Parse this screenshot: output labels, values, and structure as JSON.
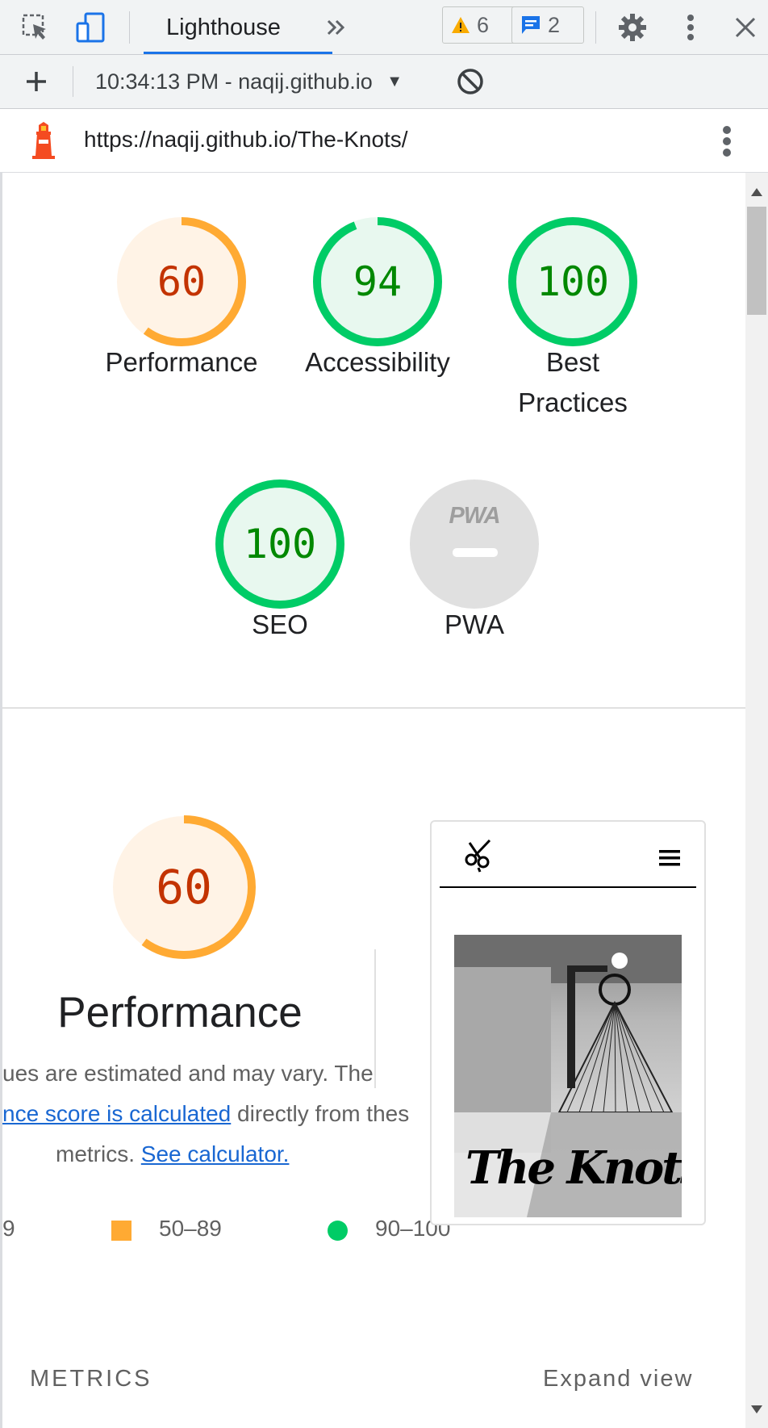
{
  "devtools": {
    "tab_label": "Lighthouse",
    "warnings_count": "6",
    "messages_count": "2",
    "report_selector": "10:34:13 PM - naqij.github.io"
  },
  "url": "https://naqij.github.io/The-Knots/",
  "scores": [
    {
      "value": "60",
      "label": "Performance",
      "score": 60,
      "color": "#fa3"
    },
    {
      "value": "94",
      "label": "Accessibility",
      "score": 94,
      "color": "#0c6"
    },
    {
      "value": "100",
      "label": "Best Practices",
      "score": 100,
      "color": "#0c6"
    },
    {
      "value": "100",
      "label": "SEO",
      "score": 100,
      "color": "#0c6"
    },
    {
      "value": "PWA",
      "label": "PWA",
      "score": null,
      "color": "#e0e0e0"
    }
  ],
  "performance": {
    "score": "60",
    "title": "Performance",
    "line1": "ues are estimated and may vary. The",
    "line2_link": "nce score is calculated",
    "line2_rest": " directly from thes",
    "line3_text": "metrics.",
    "line3_link": "See calculator.",
    "legend_fail": "9",
    "legend_average": "50–89",
    "legend_pass": "90–100",
    "screenshot_caption": "The Knots"
  },
  "metrics_label": "METRICS",
  "expand_label": "Expand view",
  "colors": {
    "average": "#fa3",
    "pass": "#0c6",
    "average_text": "#c33300",
    "pass_text": "#080",
    "link": "#1967d2"
  }
}
